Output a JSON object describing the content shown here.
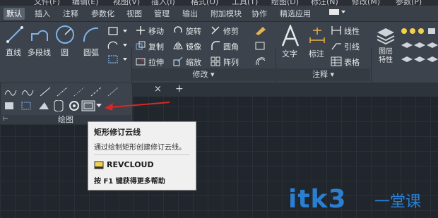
{
  "menu": [
    "文件(F)",
    "编辑(E)",
    "视图(V)",
    "插入(I)",
    "格式(O)",
    "工具(T)",
    "绘图(D)",
    "标注(N)",
    "修改(M)",
    "参数(P)"
  ],
  "tabs": [
    "默认",
    "插入",
    "注释",
    "参数化",
    "视图",
    "管理",
    "输出",
    "附加模块",
    "协作",
    "精选应用"
  ],
  "draw_panel": {
    "line": "直线",
    "polyline": "多段线",
    "circle": "圆",
    "arc": "圆弧",
    "title": "绘图"
  },
  "modify_panel": {
    "move": "移动",
    "rotate": "旋转",
    "trim": "修剪",
    "copy": "复制",
    "mirror": "镜像",
    "fillet": "圆角",
    "stretch": "拉伸",
    "scale": "缩放",
    "array": "阵列",
    "title": "修改"
  },
  "annotation_panel": {
    "text": "文字",
    "dimension": "标注",
    "linear": "线性",
    "leader": "引线",
    "table": "表格",
    "title": "注释"
  },
  "layers_panel": {
    "properties": "图层\n特性",
    "properties_l1": "图层",
    "properties_l2": "特性"
  },
  "doc_tab_close": "×",
  "doc_tab_add": "+",
  "tooltip": {
    "title": "矩形修订云线",
    "description": "通过绘制矩形创建修订云线。",
    "command": "REVCLOUD",
    "help": "按 F1 键获得更多帮助"
  },
  "watermark": {
    "brand": "itk3",
    "suffix": "一堂课"
  },
  "colors": {
    "accent": "#2a7fd1",
    "arrow": "#d62828",
    "ribbon": "#3c434c"
  }
}
